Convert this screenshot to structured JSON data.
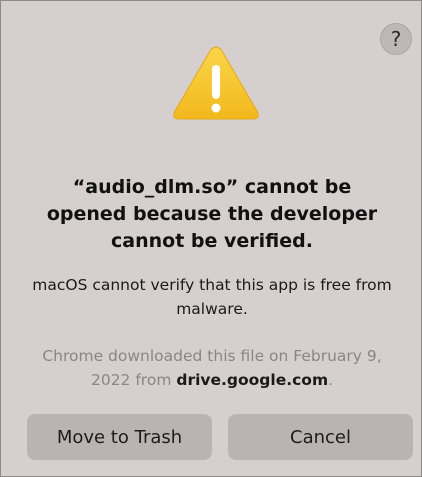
{
  "dialog": {
    "help_label": "?",
    "icon": "warning-triangle-icon",
    "title": "“audio_dlm.so” cannot be opened because the developer cannot be verified.",
    "message": "macOS cannot verify that this app is free from malware.",
    "info_prefix": "Chrome downloaded this file on February 9, 2022 from ",
    "info_domain": "drive.google.com",
    "info_suffix": ".",
    "buttons": {
      "move_to_trash": "Move to Trash",
      "cancel": "Cancel"
    }
  },
  "colors": {
    "background": "#d5d0cf",
    "warning_fill": "#f6c631",
    "button_bg": "#b9b4b3"
  }
}
